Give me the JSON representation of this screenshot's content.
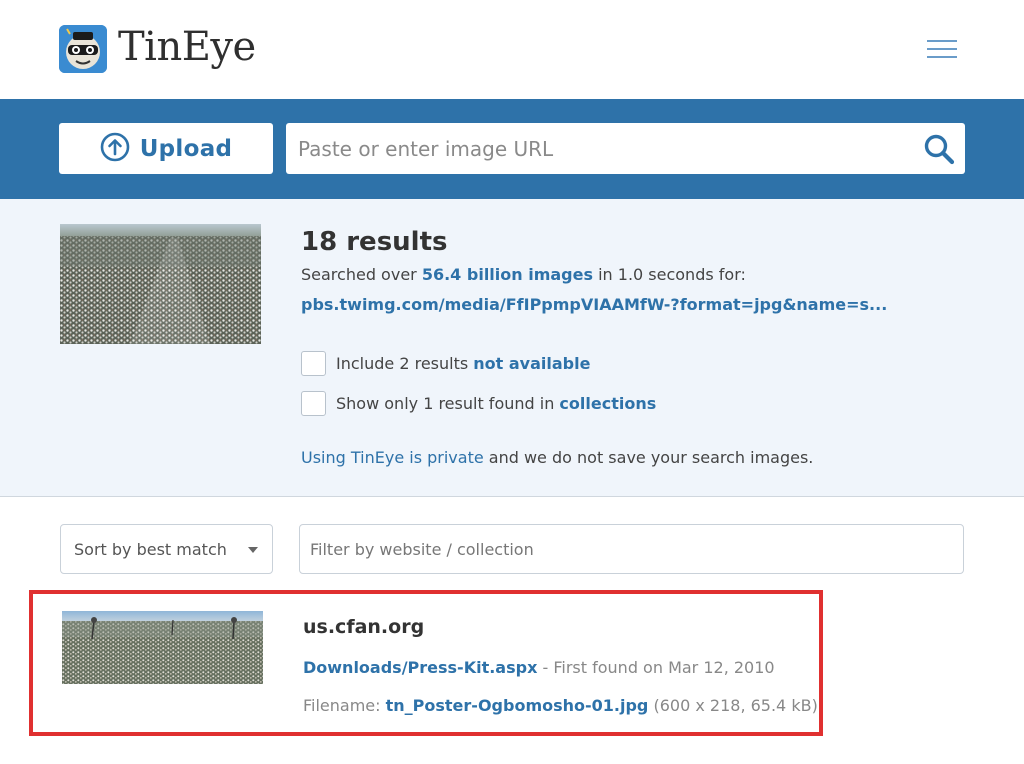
{
  "brand": {
    "name": "TinEye",
    "logo_icon": "tineye-robot-logo-icon",
    "accent": "#2e72a9"
  },
  "header": {
    "menu_icon": "hamburger-menu-icon"
  },
  "search": {
    "upload_label": "Upload",
    "upload_icon": "upload-arrow-icon",
    "url_placeholder": "Paste or enter image URL",
    "search_icon": "search-icon"
  },
  "summary": {
    "count": "18 results",
    "searched_prefix": "Searched over ",
    "searched_link": "56.4 billion images",
    "searched_suffix": " in 1.0 seconds for:",
    "query_url": "pbs.twimg.com/media/FfIPpmpVIAAMfW-?format=jpg&name=s...",
    "options": [
      {
        "prefix": "Include 2 results ",
        "link": "not available"
      },
      {
        "prefix": "Show only 1 result found in ",
        "link": "collections"
      }
    ],
    "privacy_link": "Using TinEye is private",
    "privacy_suffix": " and we do not save your search images."
  },
  "controls": {
    "sort_label": "Sort by best match",
    "filter_placeholder": "Filter by website / collection"
  },
  "results": [
    {
      "domain": "us.cfan.org",
      "page_link": "Downloads/Press-Kit.aspx",
      "first_found": " - First found on Mar 12, 2010",
      "filename_label": "Filename: ",
      "filename": "tn_Poster-Ogbomosho-01.jpg",
      "file_info": " (600 x 218, 65.4 kB)"
    }
  ],
  "highlight_color": "#e03030"
}
